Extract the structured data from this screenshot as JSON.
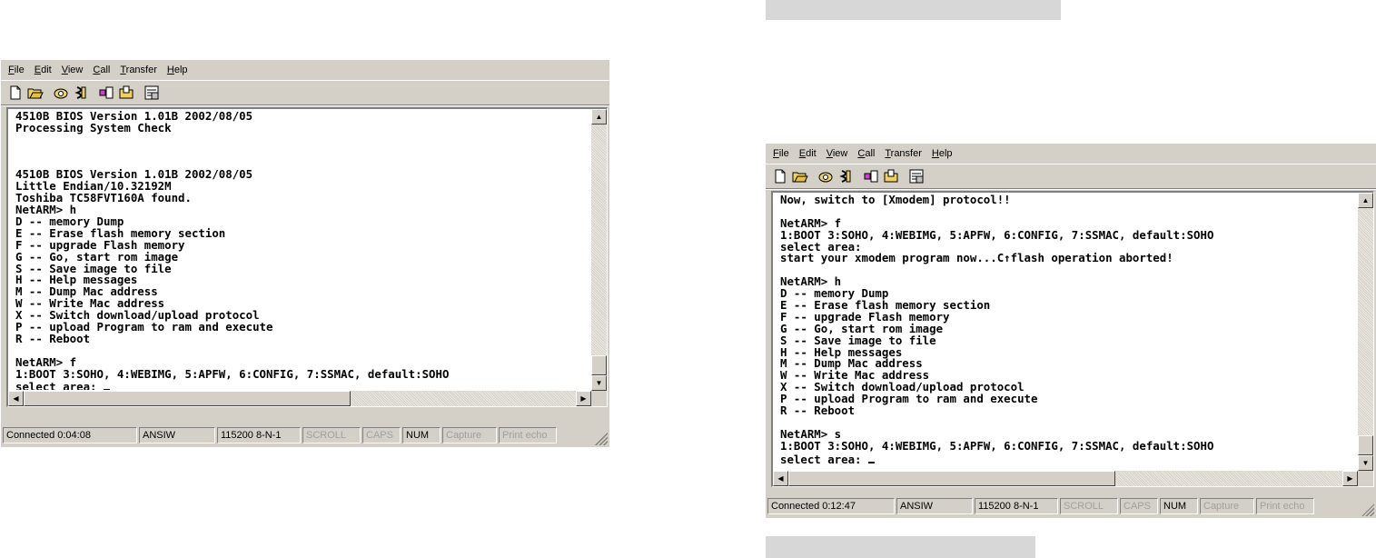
{
  "menu": [
    "File",
    "Edit",
    "View",
    "Call",
    "Transfer",
    "Help"
  ],
  "windows": [
    {
      "terminal_lines": [
        "4510B BIOS Version 1.01B 2002/08/05",
        "Processing System Check",
        "",
        "",
        "",
        "4510B BIOS Version 1.01B 2002/08/05",
        "Little Endian/10.32192M",
        "Toshiba TC58FVT160A found.",
        "NetARM> h",
        "D -- memory Dump",
        "E -- Erase flash memory section",
        "F -- upgrade Flash memory",
        "G -- Go, start rom image",
        "S -- Save image to file",
        "H -- Help messages",
        "M -- Dump Mac address",
        "W -- Write Mac address",
        "X -- Switch download/upload protocol",
        "P -- upload Program to ram and execute",
        "R -- Reboot",
        "",
        "NetARM> f",
        "1:BOOT 3:SOHO, 4:WEBIMG, 5:APFW, 6:CONFIG, 7:SSMAC, default:SOHO",
        "select area: "
      ],
      "status": {
        "connected": "Connected 0:04:08",
        "emulation": "ANSIW",
        "port": "115200 8-N-1",
        "scroll": "SCROLL",
        "caps": "CAPS",
        "num": "NUM",
        "capture": "Capture",
        "print_echo": "Print echo"
      }
    },
    {
      "terminal_lines": [
        "Now, switch to [Xmodem] protocol!!",
        "",
        "NetARM> f",
        "1:BOOT 3:SOHO, 4:WEBIMG, 5:APFW, 6:CONFIG, 7:SSMAC, default:SOHO",
        "select area:",
        "start your xmodem program now...C↑flash operation aborted!",
        "",
        "NetARM> h",
        "D -- memory Dump",
        "E -- Erase flash memory section",
        "F -- upgrade Flash memory",
        "G -- Go, start rom image",
        "S -- Save image to file",
        "H -- Help messages",
        "M -- Dump Mac address",
        "W -- Write Mac address",
        "X -- Switch download/upload protocol",
        "P -- upload Program to ram and execute",
        "R -- Reboot",
        "",
        "NetARM> s",
        "1:BOOT 3:SOHO, 4:WEBIMG, 5:APFW, 6:CONFIG, 7:SSMAC, default:SOHO",
        "select area: "
      ],
      "status": {
        "connected": "Connected 0:12:47",
        "emulation": "ANSIW",
        "port": "115200 8-N-1",
        "scroll": "SCROLL",
        "caps": "CAPS",
        "num": "NUM",
        "capture": "Capture",
        "print_echo": "Print echo"
      }
    }
  ],
  "toolbar_icons": [
    "new-icon",
    "open-icon",
    "connect-icon",
    "disconnect-icon",
    "send-icon",
    "receive-icon",
    "properties-icon"
  ],
  "colors": {
    "window_bg": "#d4d0c8",
    "terminal_bg": "#ffffff",
    "placeholder_bar": "#d7d7d7"
  }
}
